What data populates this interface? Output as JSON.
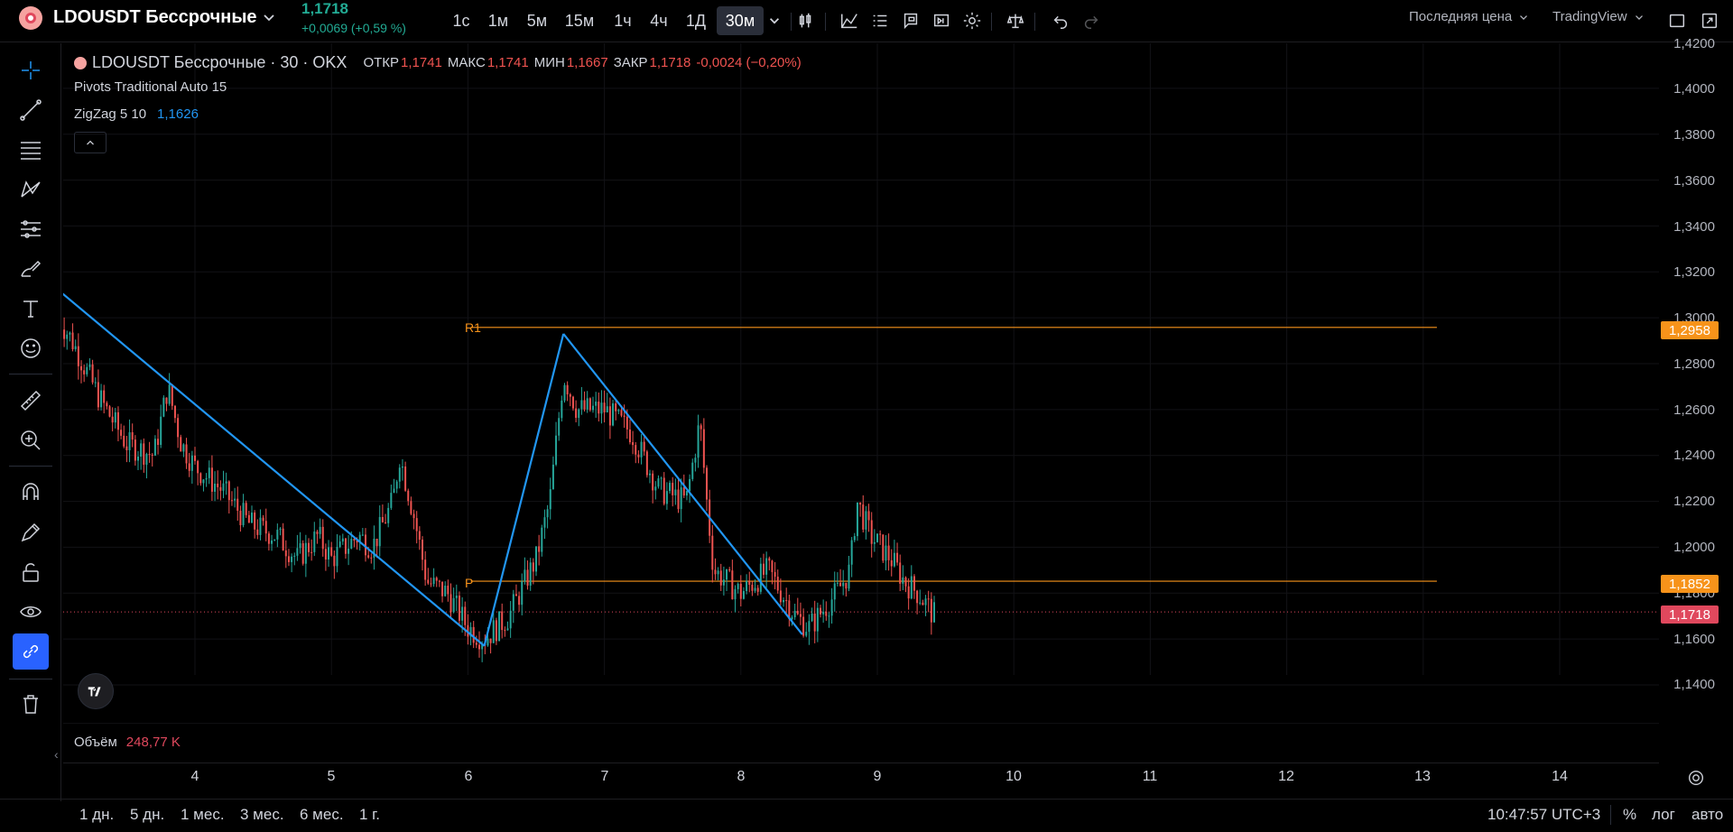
{
  "symbol": {
    "name": "LDOUSDT Бессрочные",
    "price": "1,1718",
    "change": "+0,0069 (+0,59 %)"
  },
  "intervals": [
    "1с",
    "1м",
    "5м",
    "15м",
    "1ч",
    "4ч",
    "1Д",
    "30м"
  ],
  "active_interval": "30м",
  "top_right": {
    "price_type": "Последняя цена",
    "data_source": "TradingView"
  },
  "legend": {
    "title": "LDOUSDT Бессрочные · 30 · OKX",
    "open_label": "ОТКР",
    "open": "1,1741",
    "high_label": "МАКС",
    "high": "1,1741",
    "low_label": "МИН",
    "low": "1,1667",
    "close_label": "ЗАКР",
    "close": "1,1718",
    "change": "-0,0024 (−0,20%)",
    "pivots": "Pivots Traditional Auto 15",
    "zigzag_label": "ZigZag 5 10",
    "zigzag_value": "1,1626"
  },
  "volume": {
    "label": "Объём",
    "value": "248,77 K"
  },
  "price_axis": [
    "1,4200",
    "1,4000",
    "1,3800",
    "1,3600",
    "1,3400",
    "1,3200",
    "1,3000",
    "1,2800",
    "1,2600",
    "1,2400",
    "1,2200",
    "1,2000",
    "1,1800",
    "1,1600",
    "1,1400"
  ],
  "price_tags": {
    "r1": "1,2958",
    "p": "1,1852",
    "last": "1,1718"
  },
  "pivot_labels": {
    "r1": "R1",
    "p": "P"
  },
  "date_axis": [
    "4",
    "5",
    "6",
    "7",
    "8",
    "9",
    "10",
    "11",
    "12",
    "13",
    "14"
  ],
  "ranges": [
    "1 дн.",
    "5 дн.",
    "1 мес.",
    "3 мес.",
    "6 мес.",
    "1 г."
  ],
  "clock": "10:47:57 UTC+3",
  "scale_options": {
    "percent": "%",
    "log": "лог",
    "auto": "авто"
  },
  "colors": {
    "up": "#26a69a",
    "down": "#ef5350",
    "pivot": "#f7931a",
    "zigzag": "#2196f3",
    "last_price": "#e0485d"
  },
  "chart_data": {
    "type": "candlestick",
    "series_name": "LDOUSDT Бессрочные",
    "ylim": [
      1.13,
      1.425
    ],
    "x_range_days": [
      3.0,
      14.3
    ],
    "pivot_lines": [
      {
        "name": "R1",
        "value": 1.2958
      },
      {
        "name": "P",
        "value": 1.1852
      }
    ],
    "zigzag": [
      {
        "x": 3.0,
        "y": 1.312
      },
      {
        "x": 6.12,
        "y": 1.157
      },
      {
        "x": 6.7,
        "y": 1.293
      },
      {
        "x": 8.45,
        "y": 1.162
      }
    ],
    "price_path": [
      [
        3.0,
        1.3
      ],
      [
        3.1,
        1.29
      ],
      [
        3.3,
        1.265
      ],
      [
        3.5,
        1.245
      ],
      [
        3.7,
        1.24
      ],
      [
        3.8,
        1.27
      ],
      [
        3.9,
        1.245
      ],
      [
        4.0,
        1.235
      ],
      [
        4.2,
        1.225
      ],
      [
        4.4,
        1.21
      ],
      [
        4.6,
        1.205
      ],
      [
        4.75,
        1.195
      ],
      [
        4.9,
        1.205
      ],
      [
        5.0,
        1.195
      ],
      [
        5.2,
        1.205
      ],
      [
        5.3,
        1.2
      ],
      [
        5.45,
        1.22
      ],
      [
        5.5,
        1.24
      ],
      [
        5.6,
        1.215
      ],
      [
        5.7,
        1.185
      ],
      [
        5.85,
        1.18
      ],
      [
        6.0,
        1.165
      ],
      [
        6.12,
        1.16
      ],
      [
        6.3,
        1.17
      ],
      [
        6.5,
        1.195
      ],
      [
        6.6,
        1.22
      ],
      [
        6.7,
        1.275
      ],
      [
        6.8,
        1.26
      ],
      [
        7.0,
        1.26
      ],
      [
        7.2,
        1.25
      ],
      [
        7.4,
        1.225
      ],
      [
        7.6,
        1.22
      ],
      [
        7.7,
        1.255
      ],
      [
        7.75,
        1.22
      ],
      [
        7.8,
        1.19
      ],
      [
        8.0,
        1.18
      ],
      [
        8.2,
        1.19
      ],
      [
        8.4,
        1.17
      ],
      [
        8.5,
        1.165
      ],
      [
        8.7,
        1.18
      ],
      [
        8.8,
        1.19
      ],
      [
        8.85,
        1.22
      ],
      [
        8.95,
        1.205
      ],
      [
        9.1,
        1.195
      ],
      [
        9.2,
        1.185
      ],
      [
        9.3,
        1.18
      ],
      [
        9.42,
        1.17
      ]
    ]
  }
}
